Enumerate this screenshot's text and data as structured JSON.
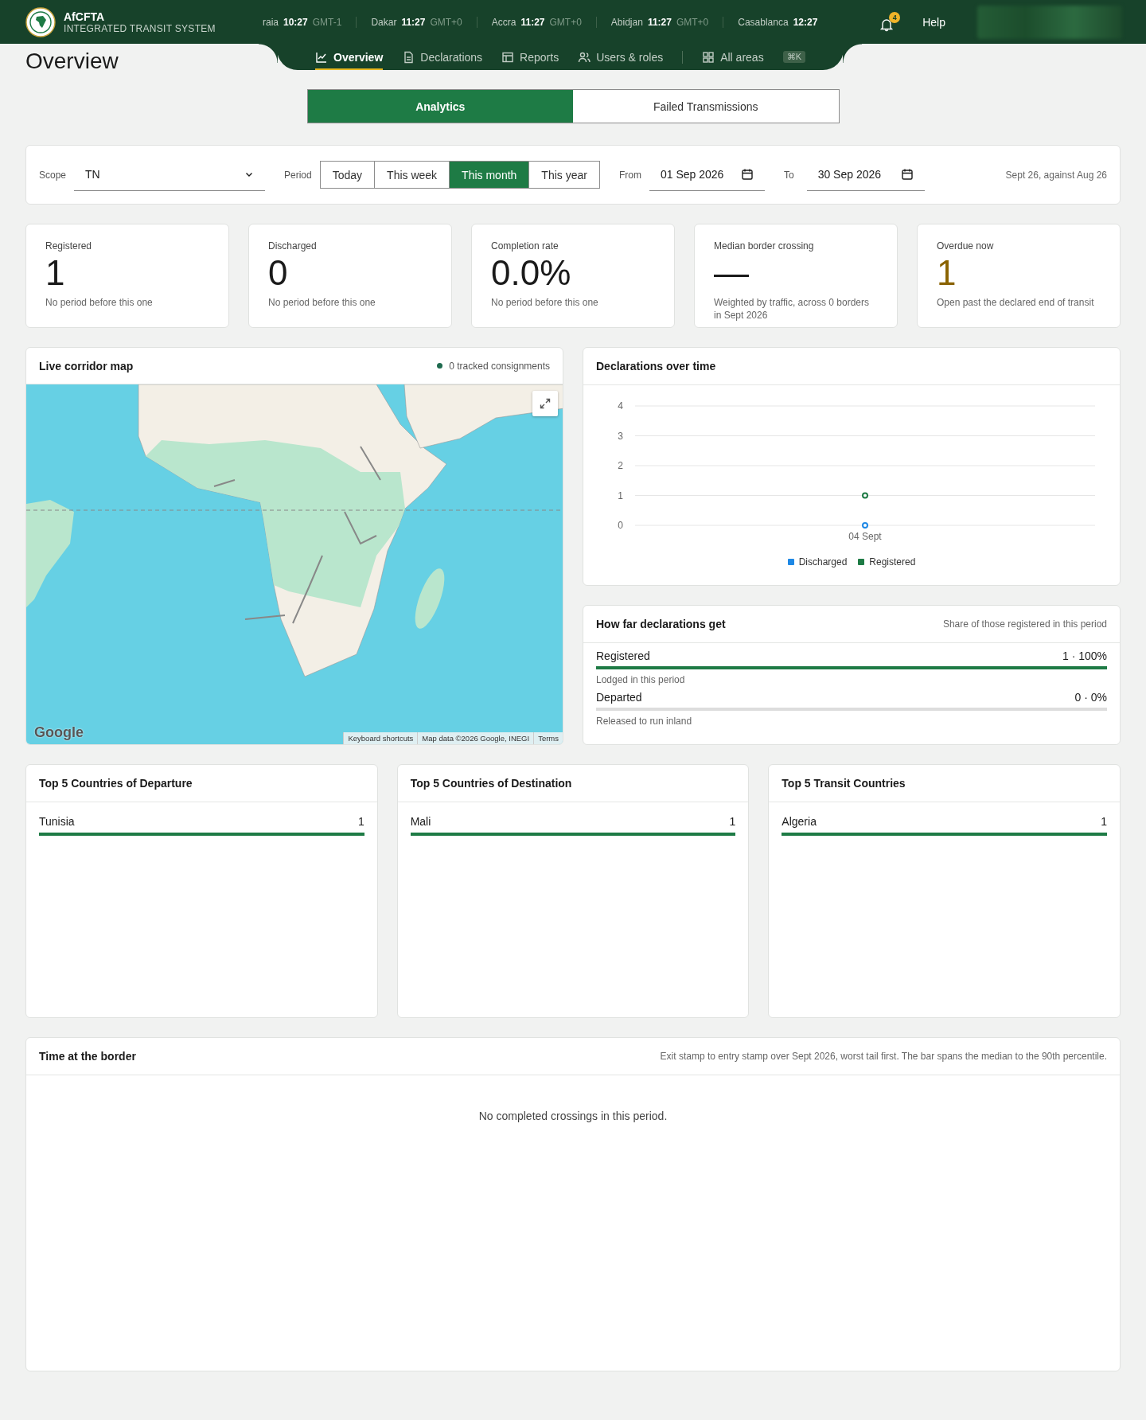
{
  "header": {
    "brand": "AfCFTA",
    "subtitle": "INTEGRATED TRANSIT SYSTEM",
    "clocks": [
      {
        "city": "raia",
        "time": "10:27",
        "zone": "GMT-1"
      },
      {
        "city": "Dakar",
        "time": "11:27",
        "zone": "GMT+0"
      },
      {
        "city": "Accra",
        "time": "11:27",
        "zone": "GMT+0"
      },
      {
        "city": "Abidjan",
        "time": "11:27",
        "zone": "GMT+0"
      },
      {
        "city": "Casablanca",
        "time": "12:27"
      }
    ],
    "notifications": "4",
    "help": "Help"
  },
  "nav": {
    "items": [
      {
        "label": "Overview",
        "selected": true
      },
      {
        "label": "Declarations",
        "selected": false
      },
      {
        "label": "Reports",
        "selected": false
      },
      {
        "label": "Users & roles",
        "selected": false
      }
    ],
    "all_areas": {
      "label": "All areas",
      "shortcut": "⌘K"
    }
  },
  "page_title": "Overview",
  "view_tabs": [
    {
      "label": "Analytics",
      "selected": true
    },
    {
      "label": "Failed Transmissions",
      "selected": false
    }
  ],
  "filters": {
    "scope_label": "Scope",
    "scope_value": "TN",
    "period_label": "Period",
    "periods": [
      {
        "label": "Today",
        "selected": false
      },
      {
        "label": "This week",
        "selected": false
      },
      {
        "label": "This month",
        "selected": true
      },
      {
        "label": "This year",
        "selected": false
      }
    ],
    "from_label": "From",
    "from_value": "01 Sep 2026",
    "to_label": "To",
    "to_value": "30 Sep 2026",
    "comparison": "Sept 26, against Aug 26"
  },
  "stats": [
    {
      "label": "Registered",
      "value": "1",
      "note": "No period before this one",
      "kind": "plain"
    },
    {
      "label": "Discharged",
      "value": "0",
      "note": "No period before this one",
      "kind": "plain"
    },
    {
      "label": "Completion rate",
      "value": "0.0%",
      "note": "No period before this one",
      "kind": "plain"
    },
    {
      "label": "Median border crossing",
      "value": "—",
      "note": "Weighted by traffic, across 0 borders in Sept 2026",
      "kind": "plain"
    },
    {
      "label": "Overdue now",
      "value": "1",
      "note": "Open past the declared end of transit",
      "kind": "alert"
    }
  ],
  "map": {
    "title": "Live corridor map",
    "tracked": "0 tracked consignments",
    "logo": "Google",
    "attribution": [
      "Keyboard shortcuts",
      "Map data ©2026 Google, INEGI",
      "Terms"
    ]
  },
  "declarations_chart": {
    "title": "Declarations over time",
    "chart_data": {
      "type": "line",
      "categories": [
        "04 Sept"
      ],
      "yticks": [
        0,
        1,
        2,
        3,
        4
      ],
      "ylim": [
        0,
        4
      ],
      "grid": true,
      "legend": true,
      "series": [
        {
          "name": "Discharged",
          "color": "#1e88e5",
          "values": [
            0
          ],
          "marker": "circle"
        },
        {
          "name": "Registered",
          "color": "#1e7b45",
          "values": [
            1
          ],
          "marker": "circle"
        }
      ]
    }
  },
  "funnel": {
    "title": "How far declarations get",
    "note": "Share of those registered in this period",
    "stages": [
      {
        "label": "Registered",
        "value": "1 · 100%",
        "level": 1,
        "note": "Lodged in this period"
      },
      {
        "label": "Departed",
        "value": "0 · 0%",
        "level": 0,
        "note": "Released to run inland"
      }
    ]
  },
  "top_lists": [
    {
      "title": "Top 5 Countries of Departure",
      "rows": [
        {
          "name": "Tunisia",
          "count": "1",
          "level": 1
        }
      ]
    },
    {
      "title": "Top 5 Countries of Destination",
      "rows": [
        {
          "name": "Mali",
          "count": "1",
          "level": 1
        }
      ]
    },
    {
      "title": "Top 5 Transit Countries",
      "rows": [
        {
          "name": "Algeria",
          "count": "1",
          "level": 1
        }
      ]
    }
  ],
  "border_time": {
    "title": "Time at the border",
    "note": "Exit stamp to entry stamp over Sept 2026, worst tail first. The bar spans the median to the 90th percentile.",
    "empty": "No completed crossings in this period."
  }
}
